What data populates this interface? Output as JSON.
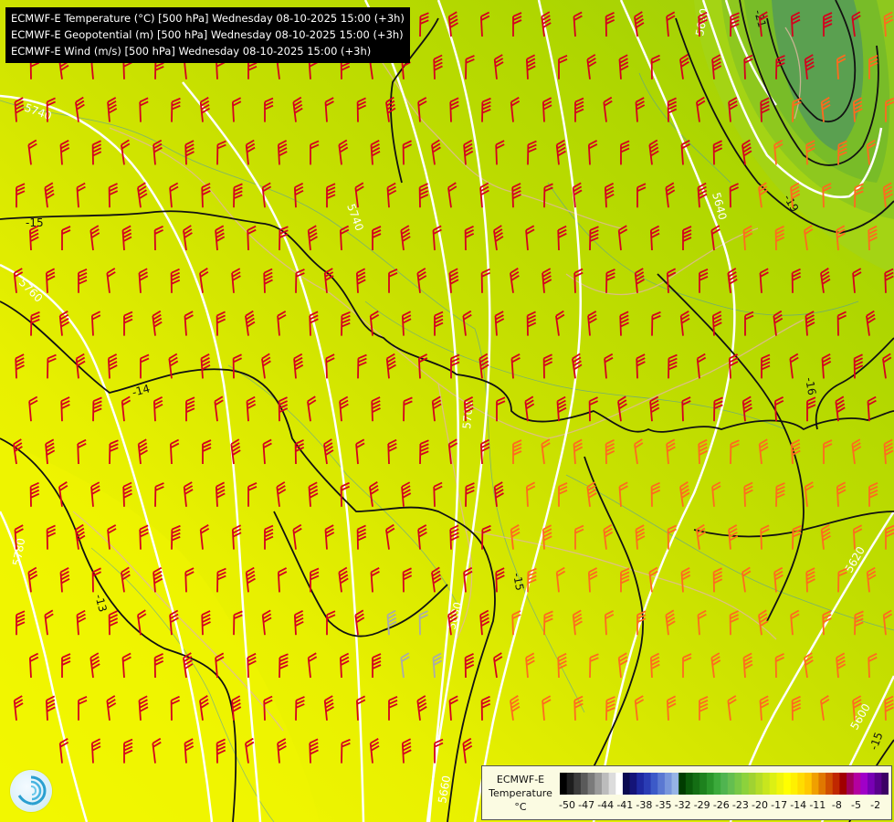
{
  "titles": [
    "ECMWF-E Temperature (°C) [500 hPa] Wednesday 08-10-2025 15:00 (+3h)",
    "ECMWF-E Geopotential (m) [500 hPa] Wednesday 08-10-2025 15:00 (+3h)",
    "ECMWF-E Wind (m/s) [500 hPa] Wednesday 08-10-2025 15:00 (+3h)"
  ],
  "legend": {
    "title_line1": "ECMWF-E",
    "title_line2": "Temperature",
    "unit": "°C",
    "tick_labels": [
      "-50",
      "-47",
      "-44",
      "-41",
      "-38",
      "-35",
      "-32",
      "-29",
      "-26",
      "-23",
      "-20",
      "-17",
      "-14",
      "-11",
      "-8",
      "-5",
      "-2"
    ],
    "colors": [
      "#000000",
      "#1e1e1e",
      "#3c3c3c",
      "#5a5a5a",
      "#7a7a7a",
      "#9a9a9a",
      "#bcbcbc",
      "#dcdcdc",
      "#ffffff",
      "#0a0a50",
      "#141478",
      "#1e28a0",
      "#2a3cb4",
      "#3c5ac8",
      "#5a78d2",
      "#7896dc",
      "#96b4e6",
      "#003c00",
      "#0a5a0a",
      "#146e14",
      "#1e821e",
      "#2a962a",
      "#3caa3c",
      "#50b450",
      "#64be50",
      "#78c846",
      "#8cd23c",
      "#a0d232",
      "#b4dc28",
      "#c8e61e",
      "#dcf014",
      "#f0f50a",
      "#ffff00",
      "#fff000",
      "#ffdc00",
      "#ffc800",
      "#f0a000",
      "#e07800",
      "#d05000",
      "#c02800",
      "#a00000",
      "#a0005a",
      "#b400a0",
      "#a000c8",
      "#7800b4",
      "#5a008c",
      "#3c0064"
    ]
  },
  "contours": {
    "geopotential_labels": [
      "5740",
      "5760",
      "5780",
      "5760",
      "5740",
      "5720",
      "5700",
      "5680",
      "5660",
      "5640",
      "5620",
      "5600",
      "5620",
      "5640"
    ],
    "temperature_labels": [
      "-15",
      "-14",
      "-13",
      "-15",
      "-21",
      "-19",
      "-16",
      "-15"
    ]
  },
  "colors": {
    "barb_red": "#d4001e",
    "barb_orange": "#ff6a1e",
    "barb_gray": "#aaaaaa",
    "border": "#e0b8a0",
    "river": "#3a8cc8"
  }
}
